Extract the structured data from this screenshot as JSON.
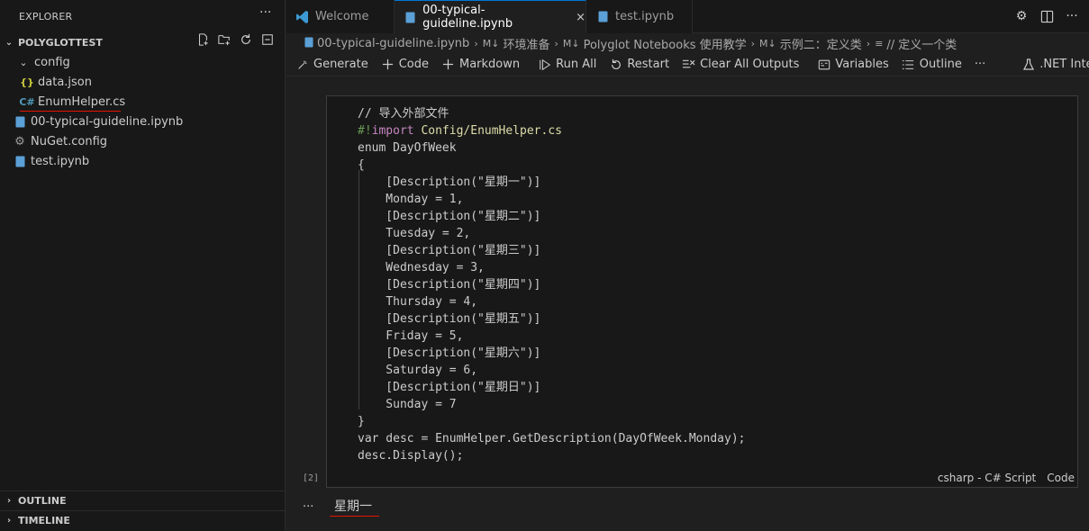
{
  "explorer": {
    "title": "EXPLORER",
    "more": "···",
    "project": "POLYGLOTTEST",
    "tree": [
      {
        "label": "config",
        "icon": "chevron-down-icon"
      },
      {
        "label": "data.json",
        "icon": "json-icon"
      },
      {
        "label": "EnumHelper.cs",
        "icon": "csharp-icon"
      },
      {
        "label": "00-typical-guideline.ipynb",
        "icon": "notebook-icon"
      },
      {
        "label": "NuGet.config",
        "icon": "gear-icon"
      },
      {
        "label": "test.ipynb",
        "icon": "notebook-icon"
      }
    ],
    "outline": "OUTLINE",
    "timeline": "TIMELINE"
  },
  "tabs": [
    {
      "label": "Welcome",
      "icon": "vscode-icon"
    },
    {
      "label": "00-typical-guideline.ipynb",
      "icon": "notebook-icon",
      "close": "×"
    },
    {
      "label": "test.ipynb",
      "icon": "notebook-icon"
    }
  ],
  "breadcrumb": [
    {
      "label": "00-typical-guideline.ipynb",
      "icon": "notebook-icon"
    },
    {
      "label": "环境准备",
      "icon": "markdown-icon"
    },
    {
      "label": "Polyglot Notebooks 使用教学",
      "icon": "markdown-icon"
    },
    {
      "label": "示例二：定义类",
      "icon": "markdown-icon"
    },
    {
      "label": "// 定义一个类",
      "icon": "list-icon"
    }
  ],
  "toolbar": {
    "generate": "Generate",
    "code": "Code",
    "markdown": "Markdown",
    "run_all": "Run All",
    "restart": "Restart",
    "clear_all": "Clear All Outputs",
    "variables": "Variables",
    "outline": "Outline",
    "more": "···",
    "kernel": ".NET Interactive"
  },
  "cell": {
    "lines": [
      "// 导入外部文件",
      "#!import Config/EnumHelper.cs",
      "enum DayOfWeek",
      "{",
      "    [Description(\"星期一\")]",
      "    Monday = 1,",
      "    [Description(\"星期二\")]",
      "    Tuesday = 2,",
      "    [Description(\"星期三\")]",
      "    Wednesday = 3,",
      "    [Description(\"星期四\")]",
      "    Thursday = 4,",
      "    [Description(\"星期五\")]",
      "    Friday = 5,",
      "    [Description(\"星期六\")]",
      "    Saturday = 6,",
      "    [Description(\"星期日\")]",
      "    Sunday = 7",
      "}",
      "var desc = EnumHelper.GetDescription(DayOfWeek.Monday);",
      "desc.Display();"
    ],
    "exec_count": "[2]",
    "language": "csharp - C# Script",
    "cell_type": "Code"
  },
  "output": {
    "more": "···",
    "text": "星期一"
  },
  "colors": {
    "accent": "#0078d4",
    "annotation_red": "#e51400",
    "directive_green": "#6a9955",
    "keyword_purple": "#c586c0"
  }
}
